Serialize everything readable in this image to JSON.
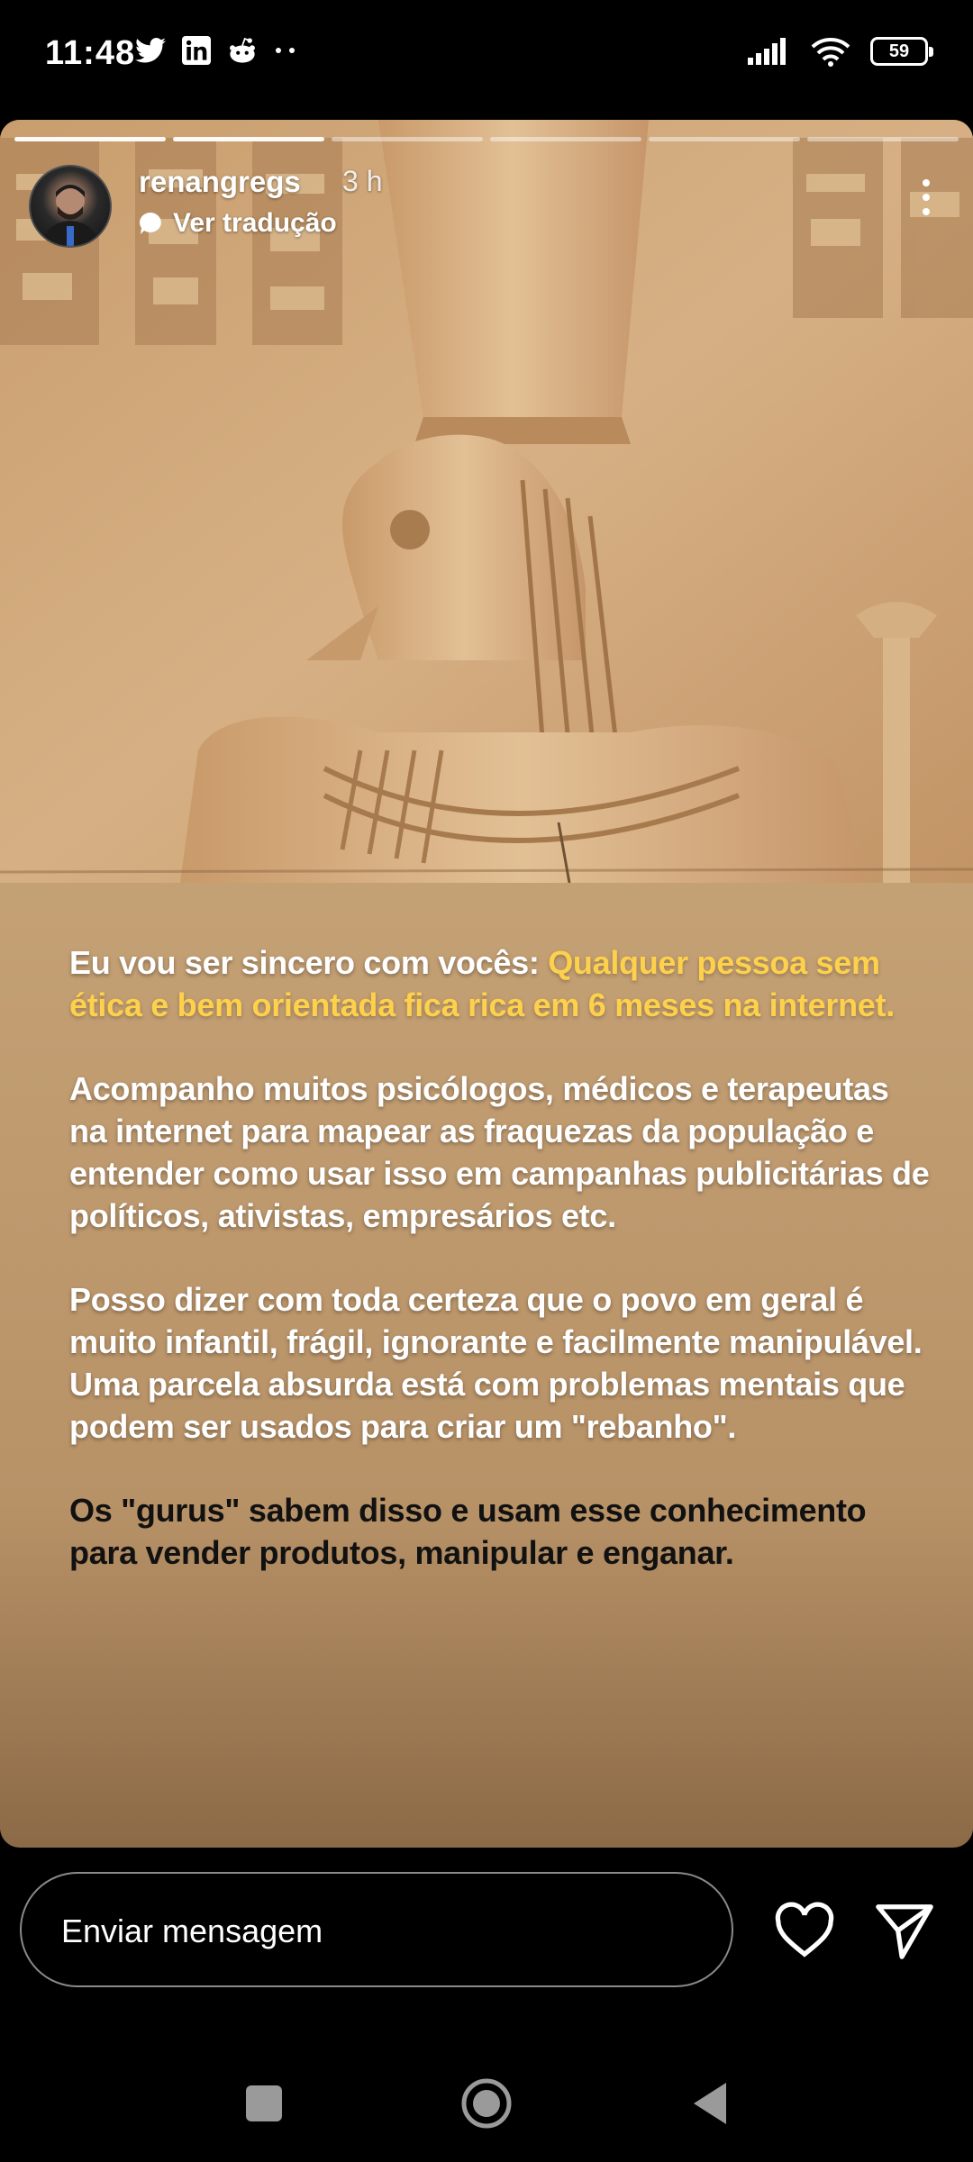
{
  "status_bar": {
    "time": "11:48",
    "battery": "59",
    "left_icons": [
      "twitter-icon",
      "linkedin-icon",
      "reddit-icon",
      "more-notifications-icon"
    ],
    "right_icons": [
      "signal-icon",
      "wifi-icon",
      "battery-icon"
    ]
  },
  "story": {
    "progress_segments": 6,
    "progress_completed": 2,
    "username": "renangregs",
    "time_ago": "3 h",
    "translate_label": "Ver tradução",
    "image": "egyptian-horus-relief",
    "caption": {
      "p1_white": "Eu vou ser sincero com vocês: ",
      "p1_yellow": "Qualquer pessoa sem ética e bem orientada fica rica em 6 meses na internet.",
      "p2": "Acompanho muitos psicólogos, médicos e terapeutas na internet para mapear as fraquezas da população e entender como usar isso em campanhas publicitárias de políticos, ativistas, empresários etc.",
      "p3": "Posso dizer com toda certeza que o povo em geral é muito infantil, frágil, ignorante e facilmente manipulável. Uma parcela absurda está com problemas mentais que podem ser usados para criar um \"rebanho\".",
      "p4": "Os \"gurus\" sabem disso e usam esse conhecimento para vender produtos, manipular e enganar."
    },
    "colors": {
      "highlight": "#fdd14c",
      "background": "#c09a6f"
    }
  },
  "reply_bar": {
    "placeholder": "Enviar mensagem"
  },
  "nav_bar": {
    "buttons": [
      "recents-square-icon",
      "home-circle-icon",
      "back-triangle-icon"
    ]
  }
}
